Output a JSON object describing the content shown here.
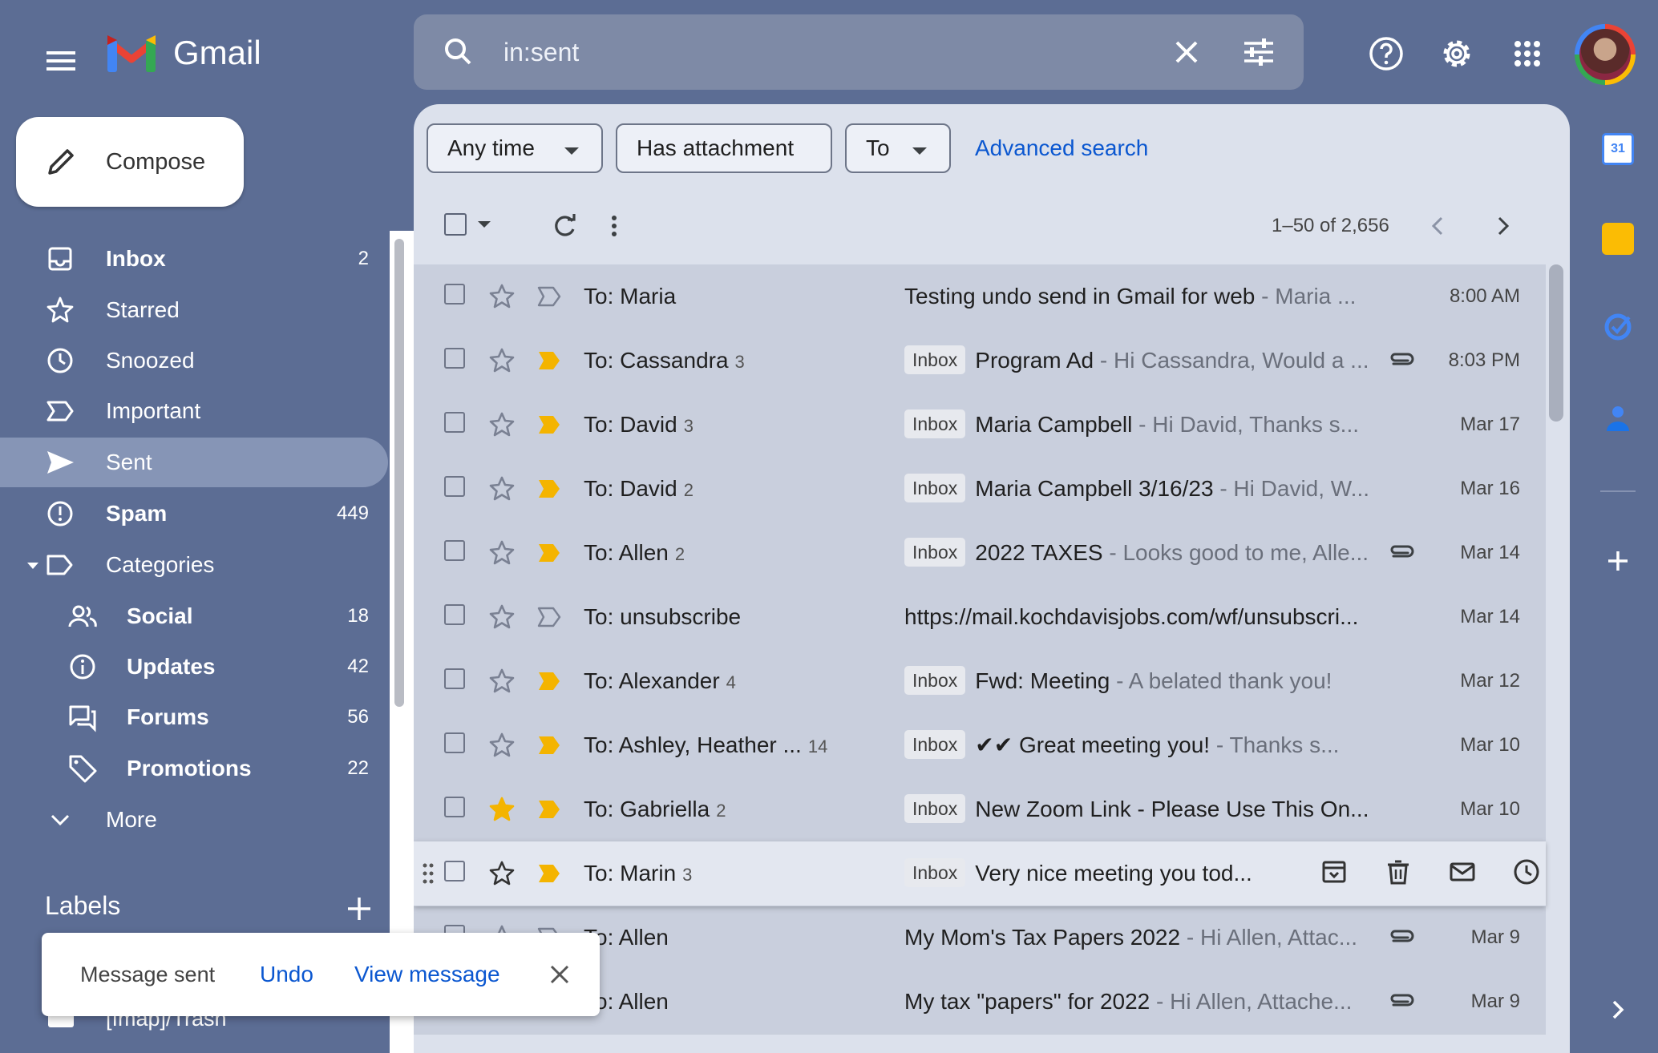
{
  "header": {
    "app_name": "Gmail",
    "search_query": "in:sent",
    "icons": [
      "menu-icon",
      "search-icon",
      "clear-search-icon",
      "search-options-icon",
      "help-icon",
      "settings-icon",
      "apps-icon"
    ]
  },
  "compose_label": "Compose",
  "nav": {
    "items": [
      {
        "label": "Inbox",
        "count": "2",
        "icon": "inbox-icon",
        "bold": true
      },
      {
        "label": "Starred",
        "count": "",
        "icon": "star-icon"
      },
      {
        "label": "Snoozed",
        "count": "",
        "icon": "clock-icon"
      },
      {
        "label": "Important",
        "count": "",
        "icon": "important-icon"
      },
      {
        "label": "Sent",
        "count": "",
        "icon": "send-icon",
        "active": true
      },
      {
        "label": "Spam",
        "count": "449",
        "icon": "spam-icon",
        "bold": true
      },
      {
        "label": "Categories",
        "count": "",
        "icon": "label-icon"
      }
    ],
    "categories": [
      {
        "label": "Social",
        "count": "18",
        "icon": "people-icon"
      },
      {
        "label": "Updates",
        "count": "42",
        "icon": "info-icon"
      },
      {
        "label": "Forums",
        "count": "56",
        "icon": "forum-icon"
      },
      {
        "label": "Promotions",
        "count": "22",
        "icon": "tag-icon"
      }
    ],
    "more_label": "More",
    "labels_heading": "Labels",
    "trash_label": "[Imap]/Trash"
  },
  "filters": {
    "any_time": "Any time",
    "has_attachment": "Has attachment",
    "to": "To",
    "advanced": "Advanced search"
  },
  "toolbar": {
    "range": "1–50 of 2,656"
  },
  "emails": [
    {
      "to": "To: Maria",
      "count": "",
      "inbox": false,
      "subject": "Testing undo send in Gmail for web",
      "snippet": " - Maria ...",
      "attachment": false,
      "date": "8:00 AM",
      "starred": false,
      "important": false
    },
    {
      "to": "To: Cassandra",
      "count": "3",
      "inbox": true,
      "subject": "Program Ad",
      "snippet": " - Hi Cassandra, Would a ...",
      "attachment": true,
      "date": "8:03 PM",
      "starred": false,
      "important": true
    },
    {
      "to": "To: David",
      "count": "3",
      "inbox": true,
      "subject": "Maria Campbell",
      "snippet": " - Hi David, Thanks s...",
      "attachment": false,
      "date": "Mar 17",
      "starred": false,
      "important": true
    },
    {
      "to": "To: David",
      "count": "2",
      "inbox": true,
      "subject": "Maria Campbell 3/16/23",
      "snippet": " - Hi David, W...",
      "attachment": false,
      "date": "Mar 16",
      "starred": false,
      "important": true
    },
    {
      "to": "To: Allen",
      "count": "2",
      "inbox": true,
      "subject": "2022 TAXES",
      "snippet": " - Looks good to me, Alle...",
      "attachment": true,
      "date": "Mar 14",
      "starred": false,
      "important": true
    },
    {
      "to": "To: unsubscribe",
      "count": "",
      "inbox": false,
      "subject": "https://mail.kochdavisjobs.com/wf/unsubscri...",
      "snippet": "",
      "attachment": false,
      "date": "Mar 14",
      "starred": false,
      "important": false
    },
    {
      "to": "To: Alexander",
      "count": "4",
      "inbox": true,
      "subject": "Fwd: Meeting",
      "snippet": " - A belated thank you!",
      "attachment": false,
      "date": "Mar 12",
      "starred": false,
      "important": true
    },
    {
      "to": "To: Ashley, Heather ...",
      "count": "14",
      "inbox": true,
      "subject": "✔✔ Great meeting you!",
      "snippet": " - Thanks s...",
      "attachment": false,
      "date": "Mar 10",
      "starred": false,
      "important": true
    },
    {
      "to": "To: Gabriella",
      "count": "2",
      "inbox": true,
      "subject": "New Zoom Link - Please Use This On...",
      "snippet": "",
      "attachment": false,
      "date": "Mar 10",
      "starred": true,
      "important": true
    },
    {
      "to": "To: Marin",
      "count": "3",
      "inbox": true,
      "subject": "Very nice meeting you tod...",
      "snippet": "",
      "attachment": false,
      "date": "",
      "starred": false,
      "important": true,
      "hovered": true
    },
    {
      "to": "To: Allen",
      "count": "",
      "inbox": false,
      "subject": "My Mom's Tax Papers 2022",
      "snippet": " - Hi Allen, Attac...",
      "attachment": true,
      "date": "Mar 9",
      "starred": false,
      "important": false
    },
    {
      "to": "To: Allen",
      "count": "",
      "inbox": false,
      "subject": "My tax \"papers\" for 2022",
      "snippet": " - Hi Allen, Attache...",
      "attachment": true,
      "date": "Mar 9",
      "starred": false,
      "important": false
    }
  ],
  "inbox_tag": "Inbox",
  "snackbar": {
    "message": "Message sent",
    "undo": "Undo",
    "view": "View message"
  },
  "colors": {
    "accent": "#0b57d0",
    "important": "#f4b400",
    "star": "#f4b400"
  }
}
